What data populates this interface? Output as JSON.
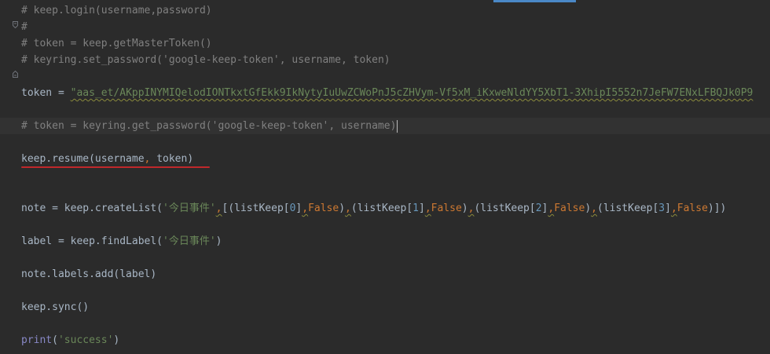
{
  "editor": {
    "lines": {
      "l1": {
        "comment": "# keep.login(username,password)"
      },
      "l2": {
        "comment": "#"
      },
      "l3": {
        "comment": "# token = keep.getMasterToken()"
      },
      "l4": {
        "comment": "# keyring.set_password('google-keep-token', username, token)"
      },
      "l6": {
        "lhs": "token = ",
        "value": "\"aas_et/AKppINYMIQelodIONTkxtGfEkk9IkNytyIuUwZCWoPnJ5cZHVym-Vf5xM_iKxweNldYY5XbT1-3XhipI5552n7JeFW7ENxLFBQJk0P9"
      },
      "l8": {
        "comment": "# token = keyring.get_password('google-keep-token', username)"
      },
      "l10": {
        "call": "keep.resume(username",
        "comma": ",",
        "rest": " token)"
      },
      "l13": {
        "p1": "note = keep.createList(",
        "s1": "'今日事件'",
        "c1": ",",
        "p2": "[(listKeep[",
        "n0": "0",
        "p3": "]",
        "c2": ",",
        "k1": "False",
        "p4": ")",
        "c3": ",",
        "p5": "(listKeep[",
        "n1": "1",
        "p6": "]",
        "c4": ",",
        "k2": "False",
        "p7": ")",
        "c5": ",",
        "p8": "(listKeep[",
        "n2": "2",
        "p9": "]",
        "c6": ",",
        "k3": "False",
        "p10": ")",
        "c7": ",",
        "p11": "(listKeep[",
        "n3": "3",
        "p12": "]",
        "c8": ",",
        "k4": "False",
        "p13": ")])"
      },
      "l15": {
        "p1": "label = keep.findLabel(",
        "s1": "'今日事件'",
        "p2": ")"
      },
      "l17": {
        "text": "note.labels.add(label)"
      },
      "l19": {
        "text": "keep.sync()"
      },
      "l21": {
        "fn": "print",
        "p1": "(",
        "s1": "'success'",
        "p2": ")"
      }
    }
  },
  "colors": {
    "background": "#2b2b2b",
    "comment": "#808080",
    "string": "#6a8759",
    "keyword": "#cc7832",
    "number": "#6897bb",
    "builtin": "#8888c6",
    "text": "#a9b7c6",
    "annotation_underline": "#c0282b",
    "scroll_thumb": "#4a88c7"
  },
  "icons": {
    "fold_start": "fold-start-icon",
    "fold_end": "fold-end-icon"
  }
}
